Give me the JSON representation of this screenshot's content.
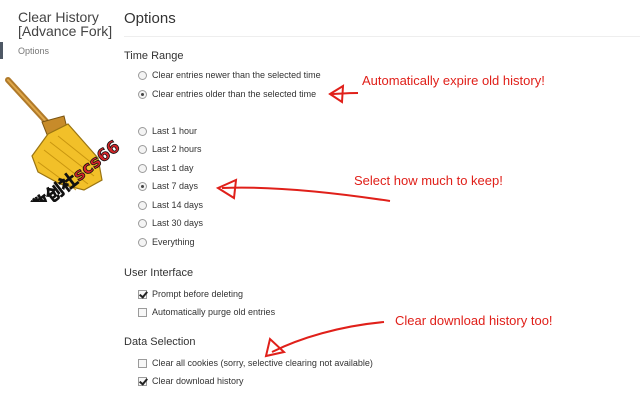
{
  "sidebar": {
    "app_title": "Clear History [Advance Fork]",
    "nav_item": "Options",
    "logo_text": "数创社scs66"
  },
  "page": {
    "title": "Options"
  },
  "time_range": {
    "heading": "Time Range",
    "mode_options": [
      {
        "label": "Clear entries newer than the selected time",
        "selected": false
      },
      {
        "label": "Clear entries older than the selected time",
        "selected": true
      }
    ],
    "periods": [
      {
        "label": "Last 1 hour",
        "selected": false
      },
      {
        "label": "Last 2 hours",
        "selected": false
      },
      {
        "label": "Last 1 day",
        "selected": false
      },
      {
        "label": "Last 7 days",
        "selected": true
      },
      {
        "label": "Last 14 days",
        "selected": false
      },
      {
        "label": "Last 30 days",
        "selected": false
      },
      {
        "label": "Everything",
        "selected": false
      }
    ]
  },
  "user_interface": {
    "heading": "User Interface",
    "options": [
      {
        "label": "Prompt before deleting",
        "checked": true
      },
      {
        "label": "Automatically purge old entries",
        "checked": false
      }
    ]
  },
  "data_selection": {
    "heading": "Data Selection",
    "options": [
      {
        "label": "Clear all cookies (sorry, selective clearing not available)",
        "checked": false
      },
      {
        "label": "Clear download history",
        "checked": true
      }
    ]
  },
  "annotations": {
    "expire": "Automatically expire old history!",
    "keep": "Select how much to keep!",
    "download": "Clear download history too!"
  },
  "colors": {
    "annotation": "#e0201a",
    "nav_indicator": "#4e5865"
  }
}
